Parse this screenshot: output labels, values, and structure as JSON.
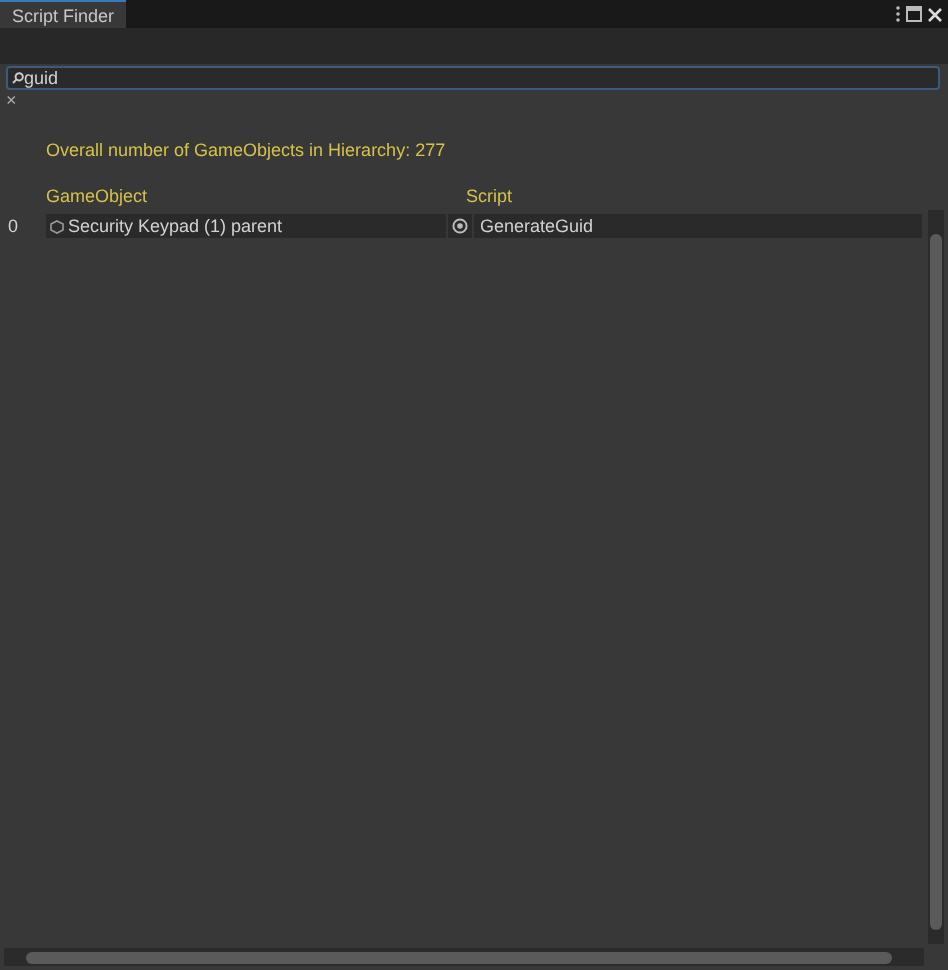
{
  "window": {
    "tab": "Script Finder"
  },
  "search": {
    "value": "guid",
    "clear": "×"
  },
  "summary": "Overall number of GameObjects in Hierarchy: 277",
  "columns": [
    "GameObject",
    "Script"
  ],
  "rows": [
    {
      "index": "0",
      "object": "Security Keypad (1) parent",
      "script": "GenerateGuid"
    }
  ]
}
